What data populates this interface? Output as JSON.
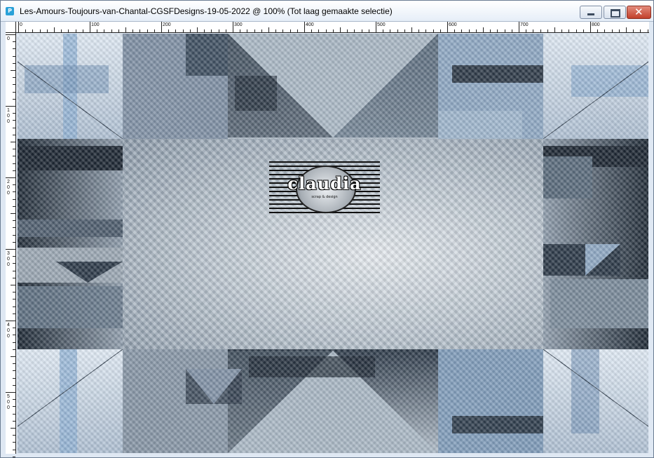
{
  "window": {
    "title": "Les-Amours-Toujours-van-Chantal-CGSFDesigns-19-05-2022 @ 100% (Tot laag gemaakte selectie)",
    "app_icon_label": "P",
    "controls": {
      "minimize_icon": "minimize-icon",
      "maximize_icon": "maximize-icon",
      "close_icon": "close-icon",
      "close_glyph": "✕"
    }
  },
  "rulers": {
    "top_labels": [
      "0",
      "100",
      "200",
      "300",
      "400",
      "500",
      "600",
      "700",
      "800"
    ],
    "left_labels": [
      "0",
      "100",
      "200",
      "300",
      "400",
      "500"
    ]
  },
  "canvas": {
    "logo": {
      "text": "claudia",
      "subtext": "scrap & design"
    },
    "colors": {
      "light_blue": "#c8d9ea",
      "steel_blue": "#6f8fb4",
      "dark_navy": "#1d2733",
      "mid_gray": "#9aa6b2",
      "center_light": "#e3e8ed"
    }
  }
}
